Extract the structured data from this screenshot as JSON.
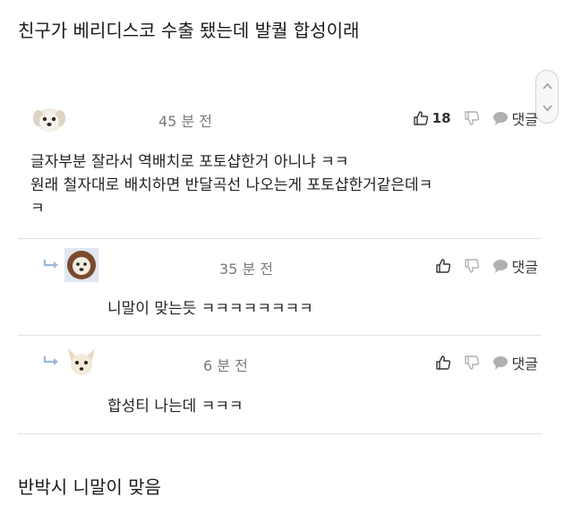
{
  "post": {
    "title": "친구가 베리디스코 수출 됐는데 발퀄 합성이래",
    "footer": "반박시 니말이 맞음"
  },
  "comments": [
    {
      "avatar": "white-puppy-avatar",
      "time": "45 분 전",
      "likes": "18",
      "reply_label": "댓글",
      "lines": [
        "글자부분 잘라서 역배치로 포토샵한거 아니냐 ㅋㅋ",
        "원래 철자대로 배치하면 반달곡선 나오는게 포토샵한거같은데ㅋ",
        "ㅋ"
      ]
    }
  ],
  "replies": [
    {
      "avatar": "lion-dog-avatar",
      "time": "35 분 전",
      "reply_label": "댓글",
      "text": "니말이 맞는듯 ㅋㅋㅋㅋㅋㅋㅋㅋ"
    },
    {
      "avatar": "chihuahua-avatar",
      "time": "6 분 전",
      "reply_label": "댓글",
      "text": "합성티 나는데 ㅋㅋㅋ"
    }
  ],
  "icons": {
    "like": "thumbs-up-icon",
    "dislike": "thumbs-down-icon",
    "reply": "speech-bubble-icon",
    "reply_arrow": "reply-arrow-icon",
    "scroll_up": "chevron-up-icon",
    "scroll_down": "chevron-down-icon"
  },
  "colors": {
    "text": "#222222",
    "muted": "#7a7a7a",
    "icon": "#b0b0b0",
    "divider": "#e2e2e2",
    "reply_arrow": "#9cb8d6"
  }
}
